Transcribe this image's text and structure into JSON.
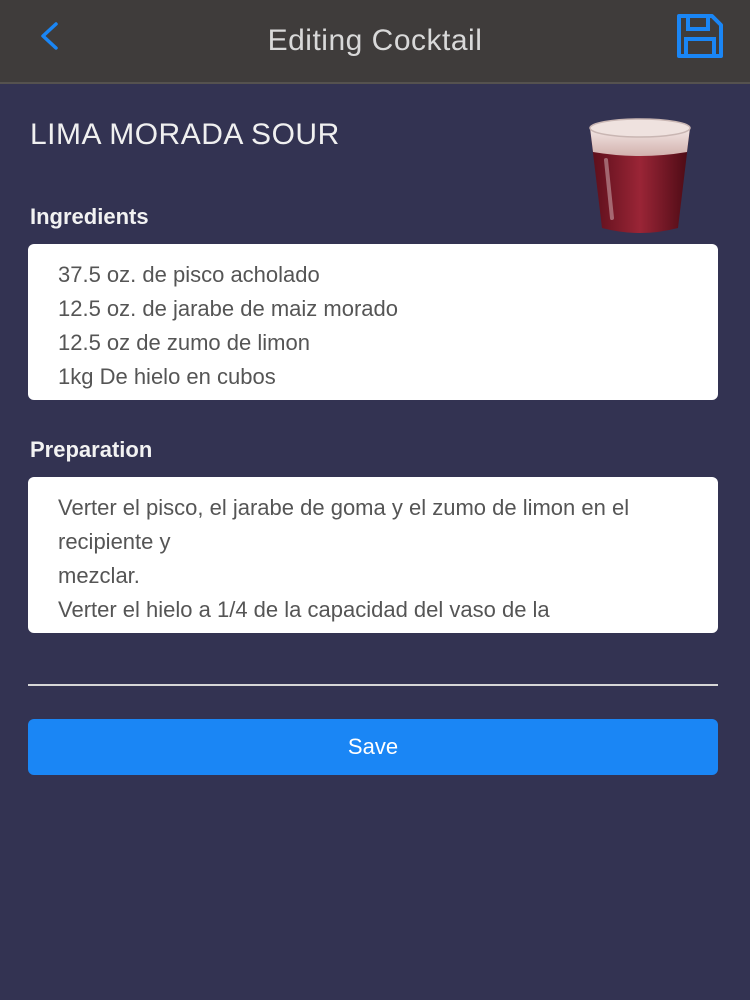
{
  "header": {
    "title": "Editing Cocktail",
    "back_icon": "chevron-left-icon",
    "save_icon": "floppy-disk-icon",
    "accent_color": "#1a86f5"
  },
  "cocktail": {
    "name": "LIMA MORADA SOUR",
    "image": "cocktail-glass-image"
  },
  "ingredients": {
    "label": "Ingredients",
    "text": "37.5 oz. de pisco acholado\n12.5 oz. de jarabe de maiz morado\n12.5 oz de zumo de limon\n1kg De hielo en cubos"
  },
  "preparation": {
    "label": "Preparation",
    "text": "Verter el pisco, el jarabe de goma y el zumo de limon en el recipiente y\nmezclar.\nVerter el hielo a 1/4 de la capacidad del vaso de la"
  },
  "actions": {
    "save_label": "Save"
  }
}
